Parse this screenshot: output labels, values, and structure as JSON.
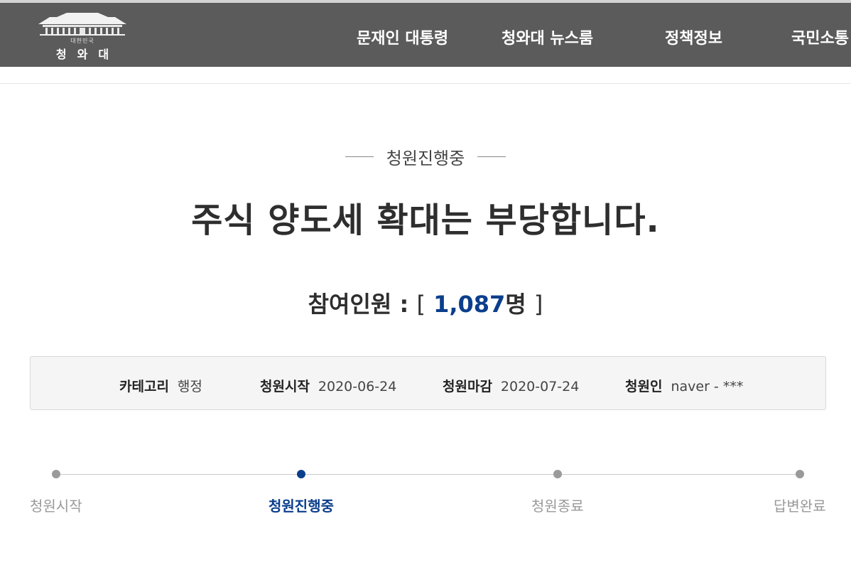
{
  "header": {
    "logo": {
      "sub": "대한민국",
      "name": "청와대"
    },
    "nav": [
      {
        "label": "문재인 대통령"
      },
      {
        "label": "청와대 뉴스룸"
      },
      {
        "label": "정책정보"
      },
      {
        "label": "국민소통"
      }
    ]
  },
  "petition": {
    "status": "청원진행중",
    "title": "주식 양도세 확대는 부당합니다.",
    "participants": {
      "label": "참여인원",
      "colon": ":",
      "open": "[",
      "count": "1,087",
      "unit": "명",
      "close": "]"
    },
    "info": {
      "category": {
        "label": "카테고리",
        "value": "행정"
      },
      "start": {
        "label": "청원시작",
        "value": "2020-06-24"
      },
      "end": {
        "label": "청원마감",
        "value": "2020-07-24"
      },
      "author": {
        "label": "청원인",
        "value": "naver - ***"
      }
    },
    "progress": {
      "active_index": 1,
      "steps": [
        {
          "label": "청원시작"
        },
        {
          "label": "청원진행중"
        },
        {
          "label": "청원종료"
        },
        {
          "label": "답변완료"
        }
      ]
    }
  },
  "colors": {
    "header_bg": "#5b5b5b",
    "accent": "#0b3e8c",
    "inactive": "#9a9a9a"
  },
  "icons": {
    "logo": "blue-house-emblem-icon"
  }
}
